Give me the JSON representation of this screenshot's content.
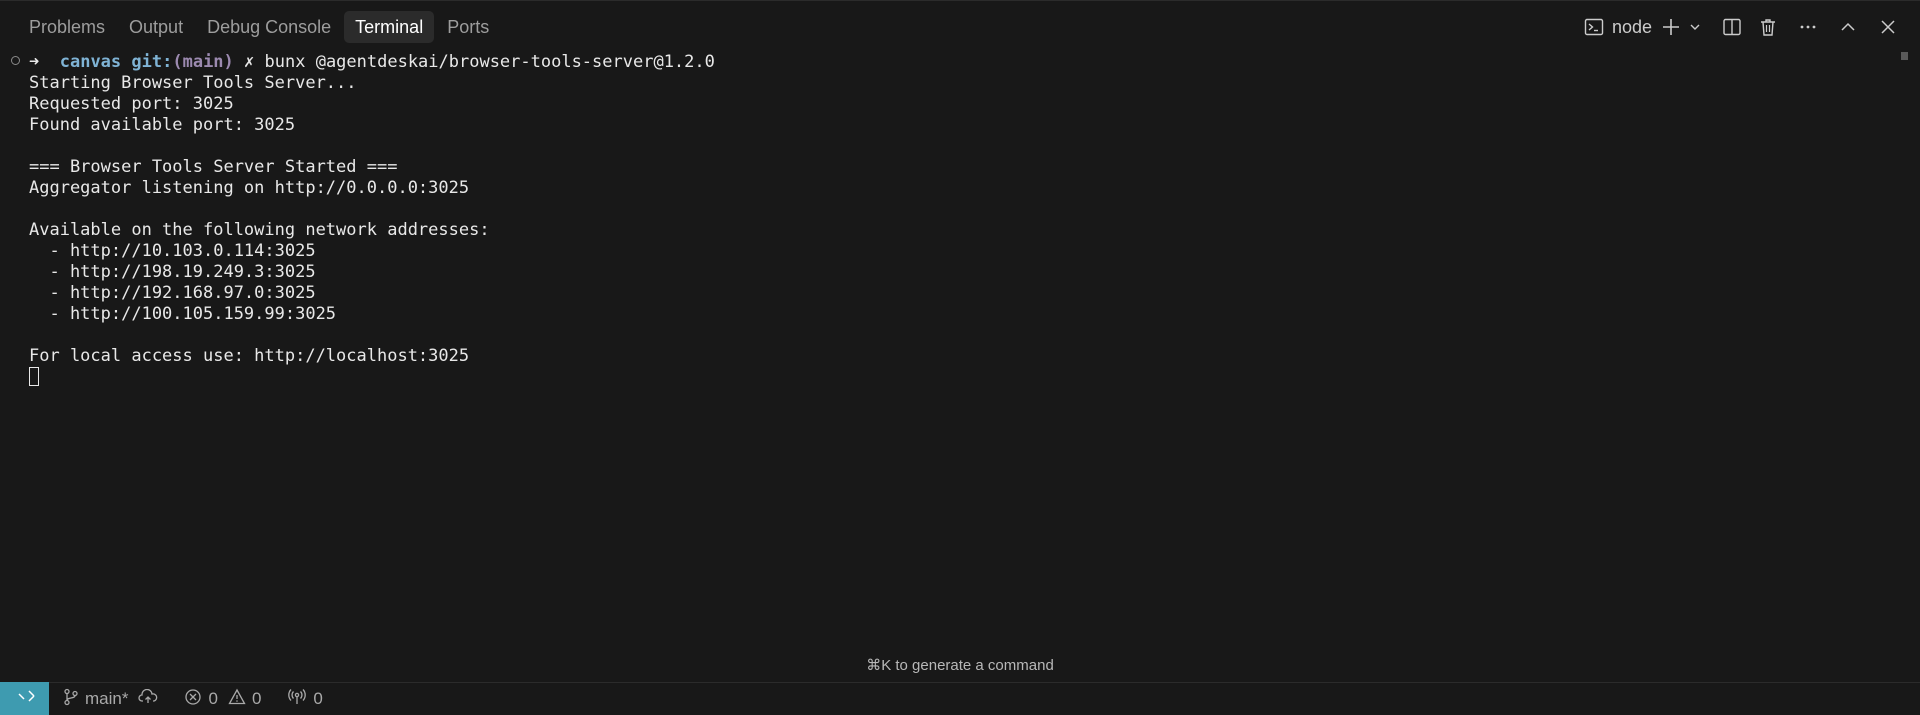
{
  "panel": {
    "tabs": [
      {
        "label": "Problems"
      },
      {
        "label": "Output"
      },
      {
        "label": "Debug Console"
      },
      {
        "label": "Terminal"
      },
      {
        "label": "Ports"
      }
    ],
    "active_tab": "Terminal",
    "terminal_name": "node",
    "icons": [
      "terminal-icon",
      "plus-icon",
      "chevron-down-icon",
      "split-icon",
      "trash-icon",
      "more-icon",
      "chevron-up-icon",
      "close-icon"
    ]
  },
  "terminal": {
    "prompt": {
      "arrow": "➜",
      "dir": "canvas",
      "git_label": "git:",
      "branch": "(main)",
      "dirty_mark": "✗",
      "command": "bunx @agentdeskai/browser-tools-server@1.2.0"
    },
    "lines": [
      "Starting Browser Tools Server...",
      "Requested port: 3025",
      "Found available port: 3025",
      "",
      "=== Browser Tools Server Started ===",
      "Aggregator listening on http://0.0.0.0:3025",
      "",
      "Available on the following network addresses:",
      "  - http://10.103.0.114:3025",
      "  - http://198.19.249.3:3025",
      "  - http://192.168.97.0:3025",
      "  - http://100.105.159.99:3025",
      "",
      "For local access use: http://localhost:3025"
    ],
    "hint": "⌘K to generate a command"
  },
  "statusbar": {
    "branch": "main*",
    "errors": "0",
    "warnings": "0",
    "ports": "0"
  },
  "colors": {
    "background": "#181818",
    "accent": "#3e9bb0",
    "active_tab_bg": "#2b2b2b"
  }
}
